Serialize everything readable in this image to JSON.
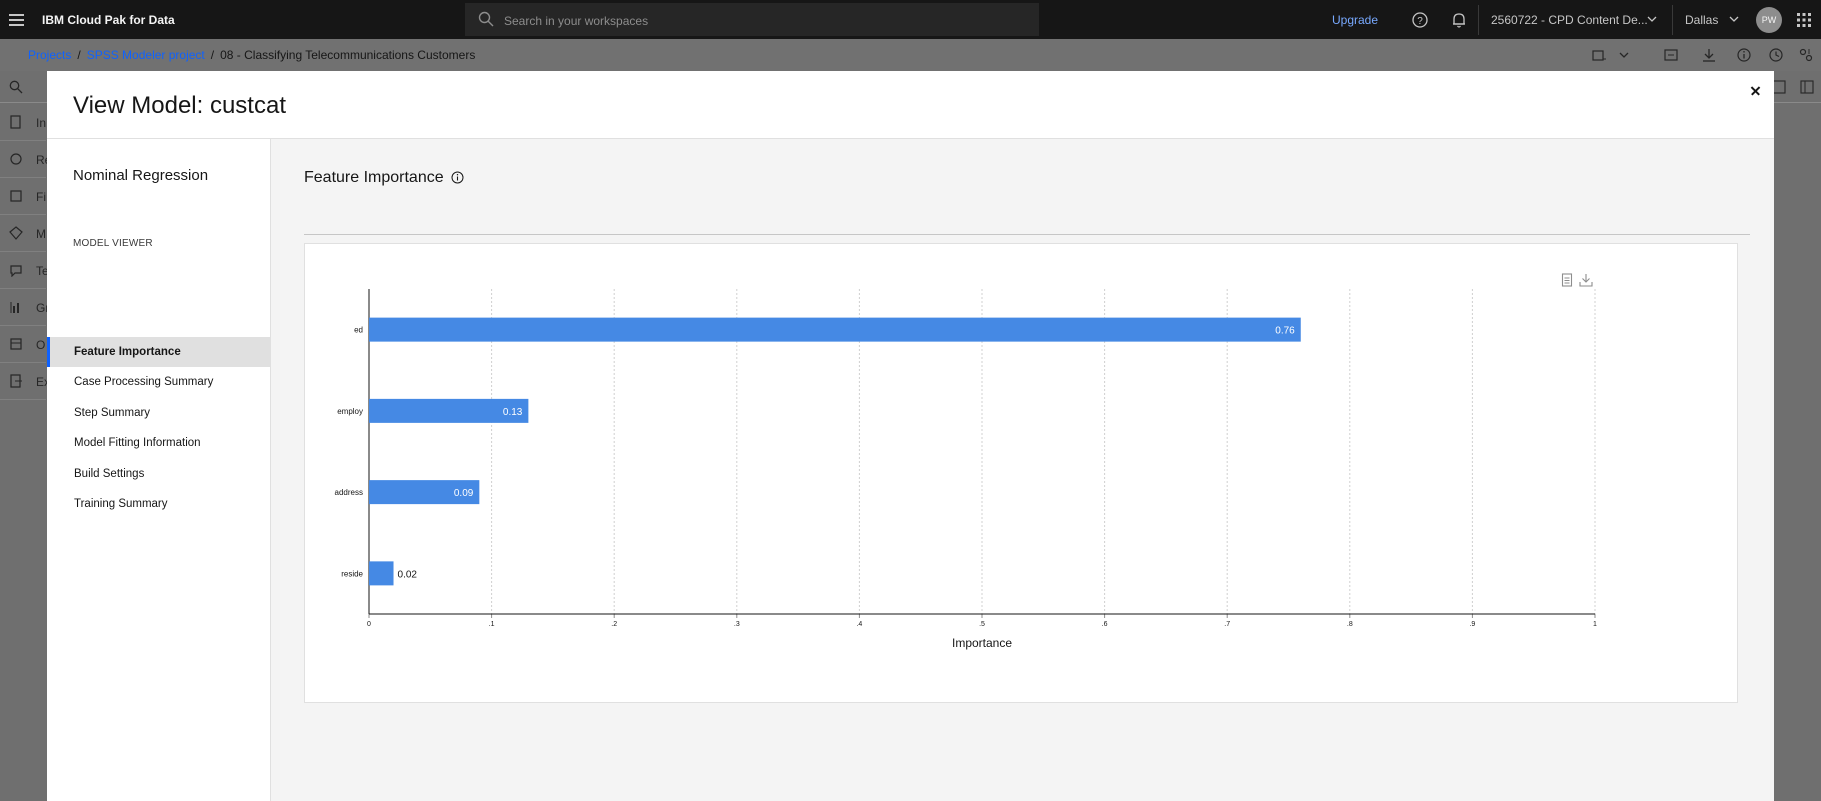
{
  "header": {
    "brand": "IBM Cloud Pak for Data",
    "search_placeholder": "Search in your workspaces",
    "upgrade": "Upgrade",
    "account": "2560722 - CPD Content De...",
    "region": "Dallas",
    "avatar_initials": "PW"
  },
  "breadcrumb": {
    "items": [
      "Projects",
      "SPSS Modeler project",
      "08 - Classifying Telecommunications Customers"
    ]
  },
  "background_rail": {
    "items": [
      "In",
      "Re",
      "Fi",
      "M",
      "Te",
      "Gr",
      "O",
      "Ex"
    ]
  },
  "modal": {
    "title": "View Model: custcat",
    "model_type": "Nominal Regression",
    "section_label": "MODEL VIEWER",
    "nav": [
      {
        "label": "Feature Importance",
        "active": true
      },
      {
        "label": "Case Processing Summary",
        "active": false
      },
      {
        "label": "Step Summary",
        "active": false
      },
      {
        "label": "Model Fitting Information",
        "active": false
      },
      {
        "label": "Build Settings",
        "active": false
      },
      {
        "label": "Training Summary",
        "active": false
      }
    ],
    "content_title": "Feature Importance"
  },
  "chart_data": {
    "type": "bar",
    "orientation": "horizontal",
    "categories": [
      "ed",
      "employ",
      "address",
      "reside"
    ],
    "values": [
      0.76,
      0.13,
      0.09,
      0.02
    ],
    "data_labels": [
      "0.76",
      "0.13",
      "0.09",
      "0.02"
    ],
    "xlabel": "Importance",
    "ylabel": "",
    "xlim": [
      0,
      1
    ],
    "xticks": [
      "0",
      ".1",
      ".2",
      ".3",
      ".4",
      ".5",
      ".6",
      ".7",
      ".8",
      ".9",
      "1"
    ],
    "grid": "vertical dashed",
    "bar_color": "#4589e4"
  }
}
